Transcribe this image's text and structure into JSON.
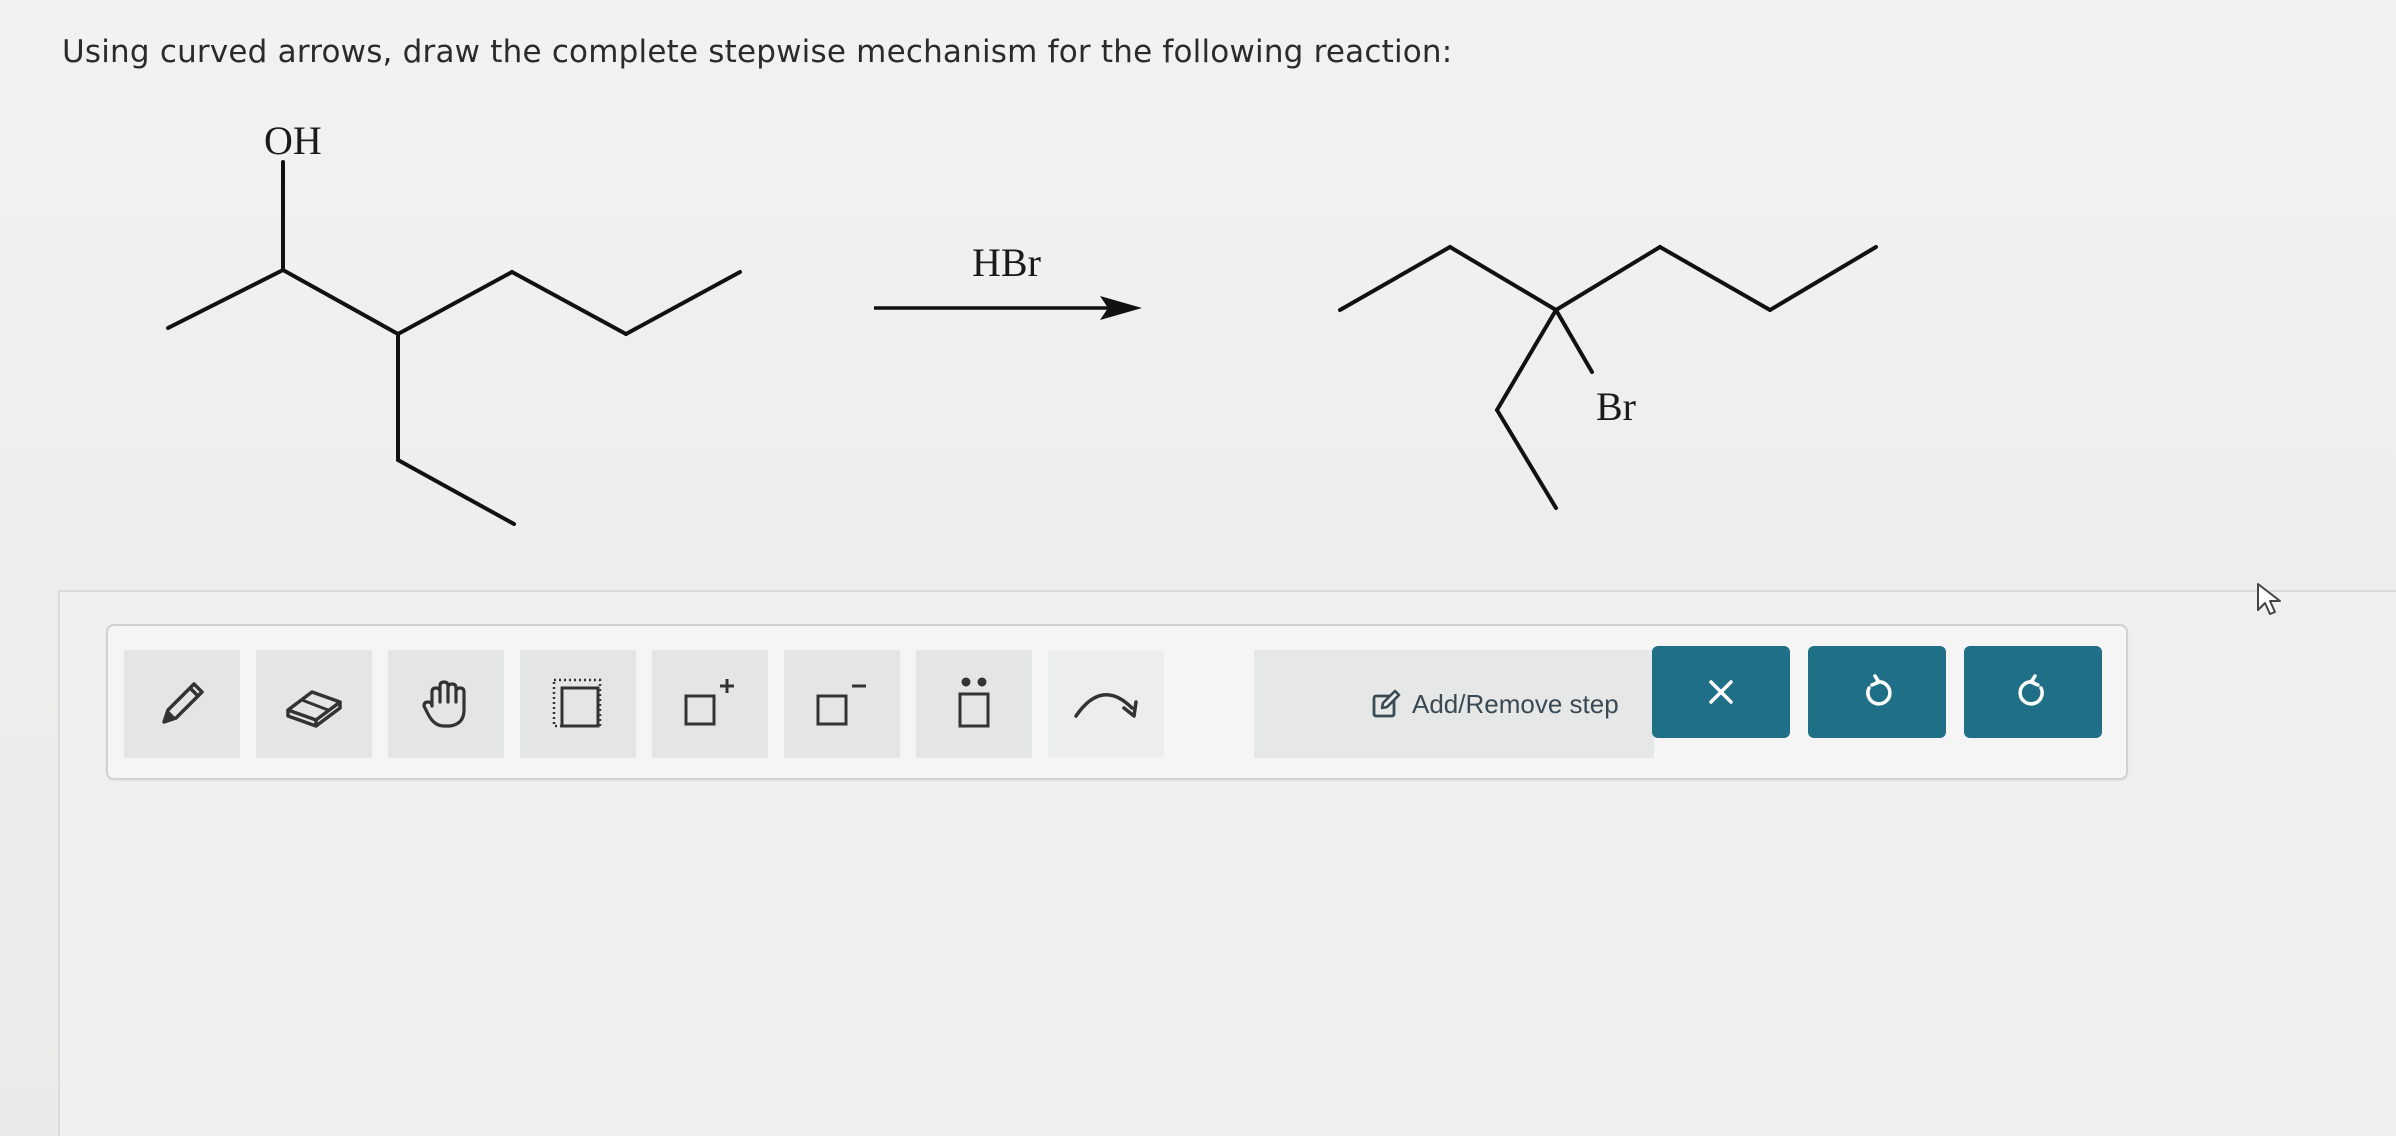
{
  "question": {
    "text": "Using curved arrows, draw the complete stepwise mechanism for the following reaction:"
  },
  "reaction": {
    "reactant_label": "OH",
    "reagent": "HBr",
    "product_label": "Br"
  },
  "toolbar": {
    "tools": [
      {
        "name": "pencil-tool",
        "icon": "pencil-icon"
      },
      {
        "name": "eraser-tool",
        "icon": "eraser-icon"
      },
      {
        "name": "hand-tool",
        "icon": "hand-icon"
      },
      {
        "name": "selection-tool",
        "icon": "dotted-square-icon"
      },
      {
        "name": "positive-charge-tool",
        "icon": "square-plus-icon"
      },
      {
        "name": "negative-charge-tool",
        "icon": "square-minus-icon"
      },
      {
        "name": "lone-pair-tool",
        "icon": "square-lone-pair-icon"
      },
      {
        "name": "curved-arrow-tool",
        "icon": "curved-arrow-icon"
      }
    ],
    "add_remove_label": "Add/Remove step",
    "buttons": {
      "clear": "×",
      "undo": "↺",
      "redo": "↻"
    }
  },
  "colors": {
    "button": "#1f6f87",
    "text": "#2b2b2b",
    "tool_bg": "#e4e6e5"
  }
}
